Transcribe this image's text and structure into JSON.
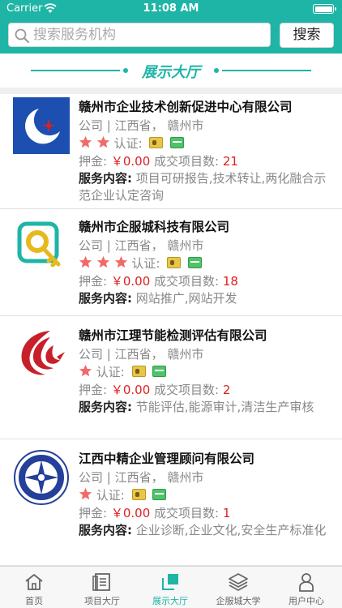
{
  "status_bar": {
    "carrier": "Carrier",
    "time": "11:08 AM"
  },
  "search": {
    "placeholder": "搜索服务机构",
    "value": "",
    "button_label": "搜索"
  },
  "section_title": "展示大厅",
  "cards": [
    {
      "name": "赣州市企业技术创新促进中心有限公司",
      "meta": "公司 | 江西省， 赣州市",
      "stars": 2,
      "cert_label": "认证:",
      "deposit_label": "押金:",
      "deposit_value": "￥0.00",
      "deals_label": "成交项目数:",
      "deals_value": "21",
      "service_label": "服务内容:",
      "service_text": "项目可研报告,技术转让,两化融合示范企业认定咨询"
    },
    {
      "name": "赣州市企服城科技有限公司",
      "meta": "公司 | 江西省， 赣州市",
      "stars": 3,
      "cert_label": "认证:",
      "deposit_label": "押金:",
      "deposit_value": "￥0.00",
      "deals_label": "成交项目数:",
      "deals_value": "18",
      "service_label": "服务内容:",
      "service_text": "网站推广,网站开发"
    },
    {
      "name": "赣州市江理节能检测评估有限公司",
      "meta": "公司 | 江西省， 赣州市",
      "stars": 1,
      "cert_label": "认证:",
      "deposit_label": "押金:",
      "deposit_value": "￥0.00",
      "deals_label": "成交项目数:",
      "deals_value": "2",
      "service_label": "服务内容:",
      "service_text": "节能评估,能源审计,清洁生产审核"
    },
    {
      "name": "江西中精企业管理顾问有限公司",
      "meta": "公司 | 江西省， 赣州市",
      "stars": 1,
      "cert_label": "认证:",
      "deposit_label": "押金:",
      "deposit_value": "￥0.00",
      "deals_label": "成交项目数:",
      "deals_value": "1",
      "service_label": "服务内容:",
      "service_text": "企业诊断,企业文化,安全生产标准化"
    }
  ],
  "tabs": [
    {
      "label": "首页",
      "icon": "home-icon"
    },
    {
      "label": "项目大厅",
      "icon": "project-hall-icon"
    },
    {
      "label": "展示大厅",
      "icon": "showcase-hall-icon",
      "active": true
    },
    {
      "label": "企服城大学",
      "icon": "university-icon"
    },
    {
      "label": "用户中心",
      "icon": "user-center-icon"
    }
  ],
  "colors": {
    "accent": "#1fb5a6",
    "price": "#e02020",
    "star": "#f06a6a"
  }
}
